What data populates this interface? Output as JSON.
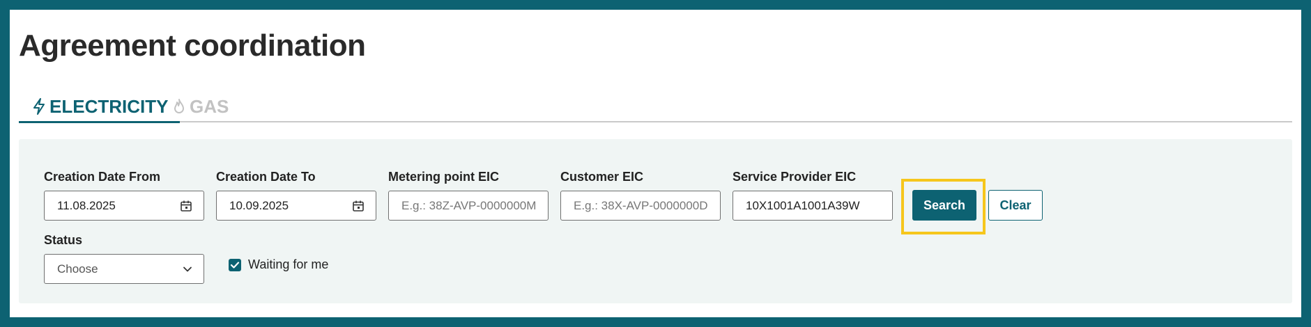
{
  "page": {
    "title": "Agreement coordination"
  },
  "tabs": [
    {
      "label": "ELECTRICITY",
      "icon": "lightning-icon",
      "active": true
    },
    {
      "label": "GAS",
      "icon": "flame-icon",
      "active": false
    }
  ],
  "filters": {
    "creation_date_from": {
      "label": "Creation Date From",
      "value": "11.08.2025",
      "icon": "calendar-icon"
    },
    "creation_date_to": {
      "label": "Creation Date To",
      "value": "10.09.2025",
      "icon": "calendar-icon"
    },
    "metering_point_eic": {
      "label": "Metering point EIC",
      "value": "",
      "placeholder": "E.g.: 38Z-AVP-0000000M"
    },
    "customer_eic": {
      "label": "Customer EIC",
      "value": "",
      "placeholder": "E.g.: 38X-AVP-0000000D"
    },
    "service_provider_eic": {
      "label": "Service Provider EIC",
      "value": "10X1001A1001A39W"
    },
    "status": {
      "label": "Status",
      "selected": "Choose",
      "icon": "chevron-down-icon"
    },
    "waiting_for_me": {
      "label": "Waiting for me",
      "checked": true
    }
  },
  "buttons": {
    "search_label": "Search",
    "clear_label": "Clear"
  },
  "colors": {
    "accent": "#0d6272",
    "highlight": "#f6c61c",
    "panel_background": "#f0f5f4",
    "inactive_tab": "#c2c2c2"
  }
}
